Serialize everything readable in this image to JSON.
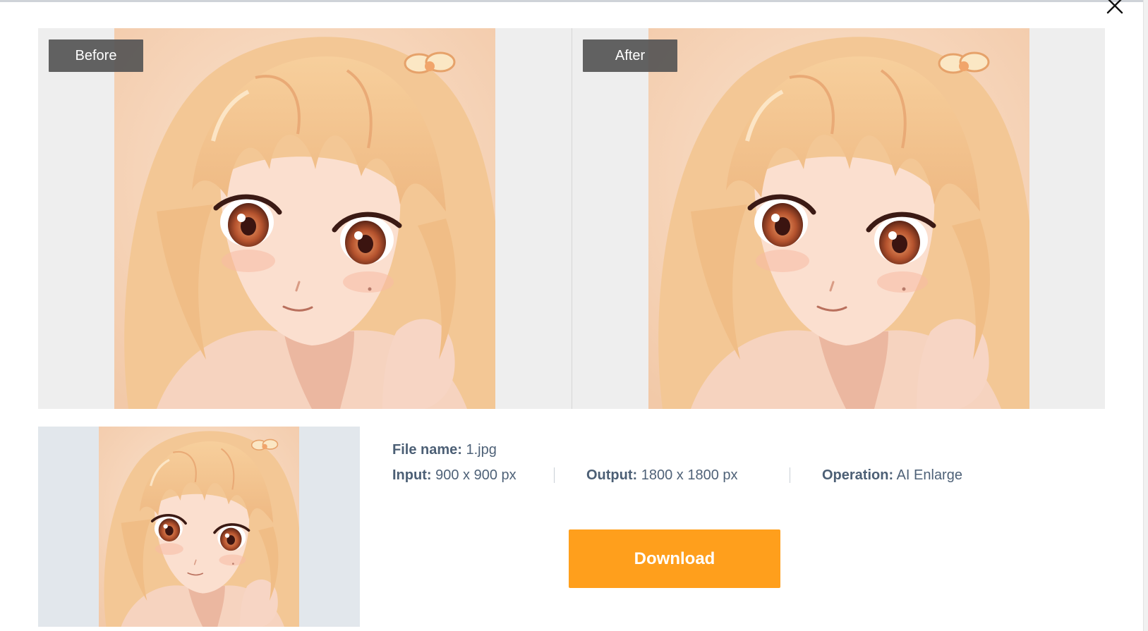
{
  "compare": {
    "before_label": "Before",
    "after_label": "After"
  },
  "file_info": {
    "file_name_label": "File name:",
    "file_name_value": "1.jpg",
    "input_label": "Input:",
    "input_value": "900 x 900 px",
    "output_label": "Output:",
    "output_value": "1800 x 1800 px",
    "operation_label": "Operation:",
    "operation_value": "AI Enlarge"
  },
  "actions": {
    "download_label": "Download"
  },
  "icons": {
    "close": "close-icon"
  },
  "colors": {
    "accent": "#ff9f1c",
    "info_text": "#4f6278",
    "pane_bg": "#eeeeee",
    "thumb_bg": "#e2e7ec"
  }
}
